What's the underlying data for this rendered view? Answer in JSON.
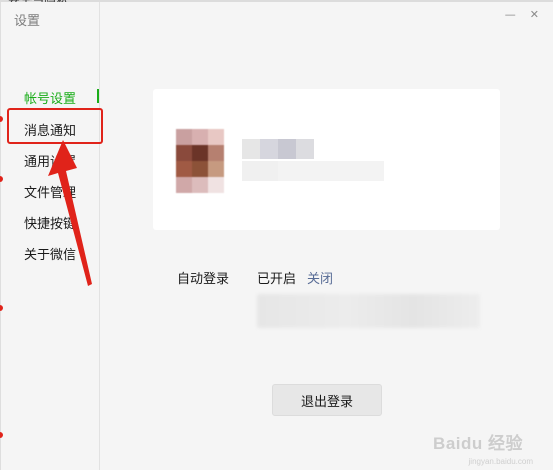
{
  "window": {
    "title": "设置",
    "minimize_glyph": "—",
    "close_glyph": "✕"
  },
  "background_strip": {
    "text": "安全与隐私"
  },
  "sidebar": {
    "items": [
      {
        "label": "帐号设置",
        "active": true
      },
      {
        "label": "消息通知",
        "active": false,
        "highlighted": true
      },
      {
        "label": "通用设置",
        "active": false
      },
      {
        "label": "文件管理",
        "active": false
      },
      {
        "label": "快捷按键",
        "active": false
      },
      {
        "label": "关于微信",
        "active": false
      }
    ]
  },
  "account": {
    "auto_login_label": "自动登录",
    "auto_login_status": "已开启",
    "auto_login_toggle": "关闭",
    "logout_label": "退出登录"
  },
  "watermark": {
    "text": "Baidu 经验",
    "sub": "jingyan.baidu.com"
  },
  "colors": {
    "accent_green": "#1aad19",
    "link_blue": "#576b95",
    "annotation_red": "#e0231a"
  }
}
